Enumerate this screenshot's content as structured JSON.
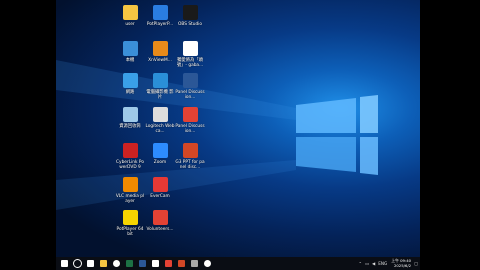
{
  "desktop_icons": [
    {
      "label": "user",
      "icon": "folder-user-icon",
      "color": "#f5c542"
    },
    {
      "label": "PotPlayerP...",
      "icon": "potplayer-icon",
      "color": "#2a7de1"
    },
    {
      "label": "OBS Studio",
      "icon": "obs-icon",
      "color": "#1a1a1a"
    },
    {
      "label": "本機",
      "icon": "computer-icon",
      "color": "#3b8fd8"
    },
    {
      "label": "XnViewM...",
      "icon": "xnview-icon",
      "color": "#e88a1a"
    },
    {
      "label": "獨愛將為「頭號」- gaba...",
      "icon": "chrome-icon",
      "color": "#ffffff"
    },
    {
      "label": "網路",
      "icon": "network-icon",
      "color": "#3aa0e8"
    },
    {
      "label": "電腦攝影機 影片",
      "icon": "video-icon",
      "color": "#2a8fd8"
    },
    {
      "label": "Panel Discussion...",
      "icon": "word-doc-icon",
      "color": "#2b5797"
    },
    {
      "label": "資源回收筒",
      "icon": "recycle-bin-icon",
      "color": "#9ec9e8"
    },
    {
      "label": "Logitech Webca...",
      "icon": "logitech-icon",
      "color": "#dddddd"
    },
    {
      "label": "Panel Discussion...",
      "icon": "pdf-doc-icon",
      "color": "#e34234"
    },
    {
      "label": "CyberLink PowerDVD 9",
      "icon": "powerdvd-icon",
      "color": "#cc2222"
    },
    {
      "label": "Zoom",
      "icon": "zoom-icon",
      "color": "#2d8cff"
    },
    {
      "label": "G3 PPT for panel disc...",
      "icon": "ppt-icon",
      "color": "#d24726"
    },
    {
      "label": "VLC media player",
      "icon": "vlc-icon",
      "color": "#f08a00"
    },
    {
      "label": "EverCam",
      "icon": "evercam-icon",
      "color": "#e53935"
    },
    {
      "label": "",
      "icon": "",
      "color": ""
    },
    {
      "label": "PotPlayer 64 bit",
      "icon": "potplayer64-icon",
      "color": "#f5d400"
    },
    {
      "label": "Volunteers...",
      "icon": "pdf-file-icon",
      "color": "#e34234"
    }
  ],
  "taskbar": {
    "items": [
      {
        "name": "start-button",
        "icon": "windows-logo-icon",
        "color": "#ffffff"
      },
      {
        "name": "search-button",
        "icon": "search-icon",
        "color": "#ffffff"
      },
      {
        "name": "task-view-button",
        "icon": "task-view-icon",
        "color": "#ffffff"
      },
      {
        "name": "file-explorer-button",
        "icon": "folder-icon",
        "color": "#f5c542"
      },
      {
        "name": "chrome-taskbar-button",
        "icon": "chrome-icon",
        "color": "#ffffff"
      },
      {
        "name": "excel-taskbar-button",
        "icon": "excel-icon",
        "color": "#1d7044"
      },
      {
        "name": "word-taskbar-button",
        "icon": "word-icon",
        "color": "#2b5797"
      },
      {
        "name": "store-taskbar-button",
        "icon": "store-icon",
        "color": "#ffffff"
      },
      {
        "name": "acrobat-taskbar-button",
        "icon": "acrobat-icon",
        "color": "#e34234"
      },
      {
        "name": "powerpoint-taskbar-button",
        "icon": "powerpoint-icon",
        "color": "#d24726"
      },
      {
        "name": "xnview-taskbar-button",
        "icon": "xnview-icon",
        "color": "#aaaaaa"
      },
      {
        "name": "obs-taskbar-button",
        "icon": "obs-icon",
        "color": "#ffffff"
      }
    ],
    "tray": {
      "language": "ENG",
      "time": "上午 09:40",
      "date": "2025/6/2"
    }
  }
}
